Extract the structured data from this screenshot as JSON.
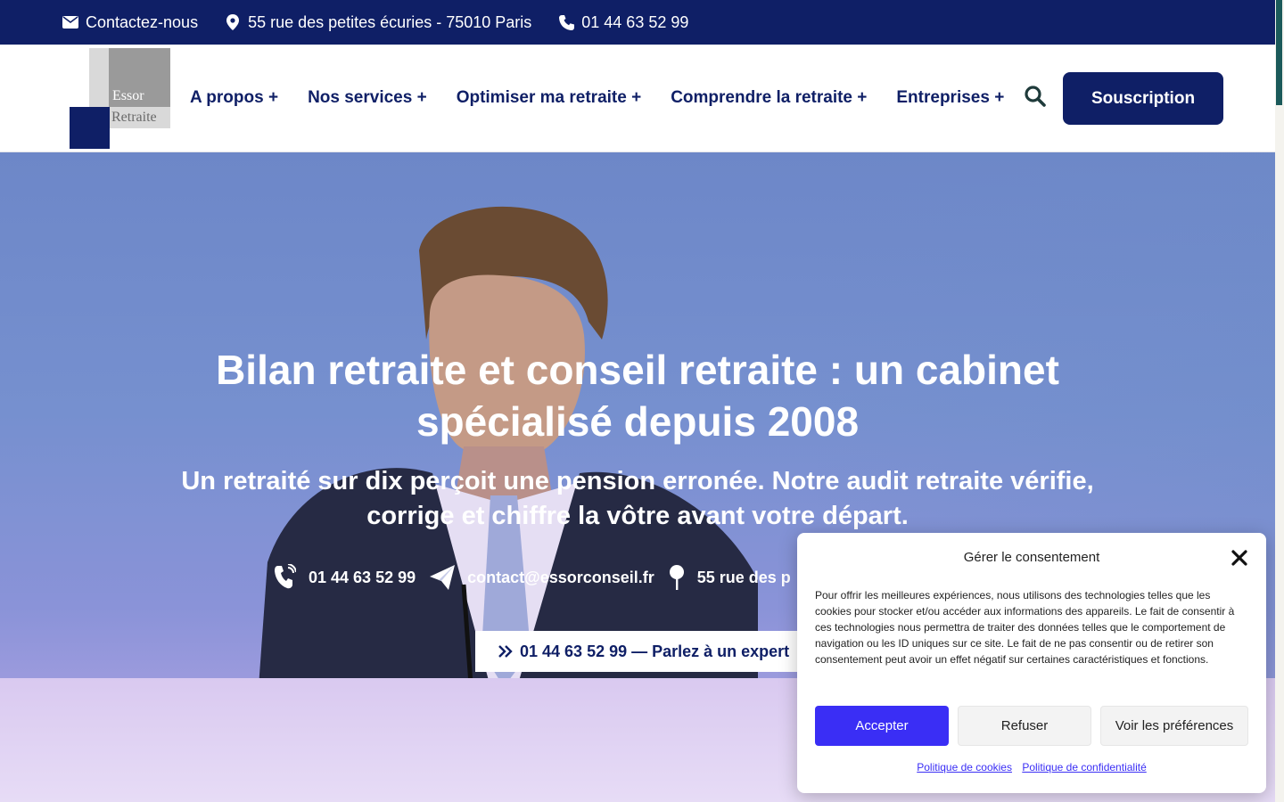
{
  "topbar": {
    "contact_label": "Contactez-nous",
    "address": "55 rue des petites écuries - 75010 Paris",
    "phone": "01 44 63 52 99"
  },
  "logo": {
    "line1": "Essor",
    "line2": "Retraite"
  },
  "nav": {
    "items": [
      "A propos +",
      "Nos services +",
      "Optimiser ma retraite +",
      "Comprendre la retraite +",
      "Entreprises +"
    ],
    "subscribe_label": "Souscription"
  },
  "hero": {
    "title_line1": "Bilan retraite et conseil retraite : un cabinet",
    "title_line2": "spécialisé depuis 2008",
    "subtitle_line1": "Un retraité sur dix perçoit une pension erronée. Notre audit retraite vérifie,",
    "subtitle_line2": "corrige et chiffre la vôtre avant votre départ.",
    "contact_phone": "01 44 63 52 99",
    "contact_email": "contact@essorconseil.fr",
    "contact_address": "55 rue des p",
    "cta_label": "01 44 63 52 99 — Parlez à un expert"
  },
  "cookie": {
    "title": "Gérer le consentement",
    "body": "Pour offrir les meilleures expériences, nous utilisons des technologies telles que les cookies pour stocker et/ou accéder aux informations des appareils. Le fait de consentir à ces technologies nous permettra de traiter des données telles que le comportement de navigation ou les ID uniques sur ce site. Le fait de ne pas consentir ou de retirer son consentement peut avoir un effet négatif sur certaines caractéristiques et fonctions.",
    "accept_label": "Accepter",
    "refuse_label": "Refuser",
    "prefs_label": "Voir les préférences",
    "link_cookies": "Politique de cookies",
    "link_privacy": "Politique de confidentialité"
  },
  "colors": {
    "navy": "#0f1f66",
    "accent": "#3a2ef5"
  }
}
